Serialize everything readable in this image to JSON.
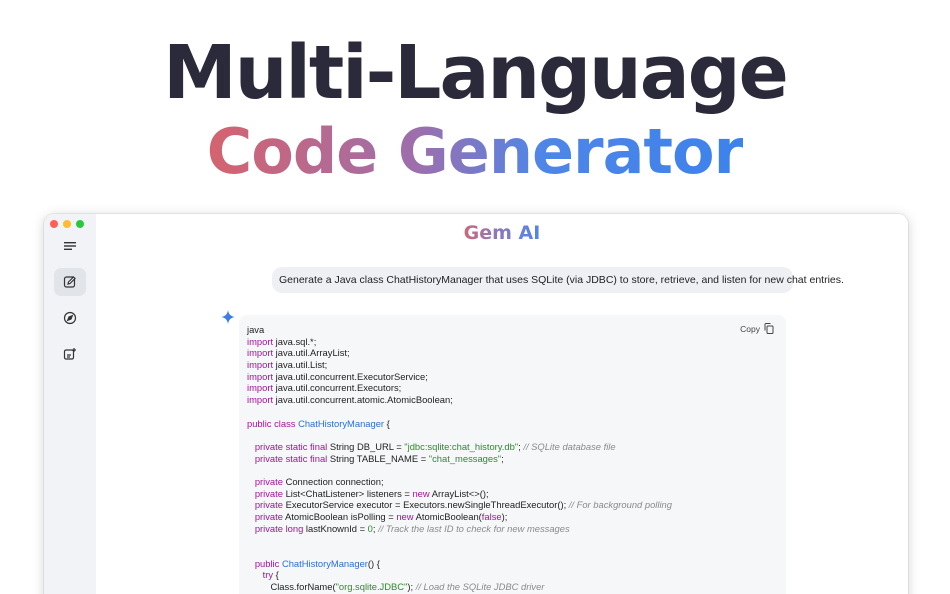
{
  "hero": {
    "title": "Multi-Language",
    "subtitle": "Code Generator"
  },
  "app": {
    "title": "Gem AI",
    "sidebar": {
      "items": [
        {
          "icon": "menu-icon"
        },
        {
          "icon": "new-chat-icon",
          "active": true
        },
        {
          "icon": "compass-icon"
        },
        {
          "icon": "add-note-icon"
        }
      ]
    }
  },
  "chat": {
    "user_message": "Generate a Java class ChatHistoryManager that uses SQLite (via JDBC) to store, retrieve, and listen for new chat entries.",
    "response": {
      "copy_label": "Copy",
      "language": "java",
      "code": {
        "import_kw": "import",
        "imports": [
          "java.sql.*;",
          "java.util.ArrayList;",
          "java.util.List;",
          "java.util.concurrent.ExecutorService;",
          "java.util.concurrent.Executors;",
          "java.util.concurrent.atomic.AtomicBoolean;"
        ],
        "class_decl": {
          "mods": "public class",
          "name": "ChatHistoryManager",
          "rest": " {"
        },
        "field1": {
          "mods": "private static final",
          "rest": " String DB_URL = ",
          "str": "\"jdbc:sqlite:chat_history.db\"",
          "end": "; ",
          "comment": "// SQLite database file"
        },
        "field2": {
          "mods": "private static final",
          "rest": " String TABLE_NAME = ",
          "str": "\"chat_messages\"",
          "end": ";"
        },
        "field3": {
          "mods": "private",
          "rest": " Connection connection;"
        },
        "field4": {
          "mods": "private",
          "rest": " List<ChatListener> listeners = ",
          "kw2": "new",
          "rest2": " ArrayList<>();"
        },
        "field5": {
          "mods": "private",
          "rest": " ExecutorService executor = Executors.newSingleThreadExecutor(); ",
          "comment": "// For background polling"
        },
        "field6": {
          "mods": "private",
          "rest": " AtomicBoolean isPolling = ",
          "kw2": "new",
          "rest2": " AtomicBoolean(",
          "kw3": "false",
          "rest3": ");"
        },
        "field7": {
          "mods": "private long",
          "rest": " lastKnownId = ",
          "num": "0",
          "end": "; ",
          "comment": "// Track the last ID to check for new messages"
        },
        "ctor": {
          "mods": "public",
          "name": "ChatHistoryManager",
          "rest": "() {"
        },
        "try_kw": "try",
        "try_rest": " {",
        "forname": {
          "rest": "Class.forName(",
          "str": "\"org.sqlite.JDBC\"",
          "end": "); ",
          "comment": "// Load the SQLite JDBC driver"
        }
      }
    }
  },
  "colors": {
    "keyword": "#a3149b",
    "class_name": "#2b6fd6",
    "string": "#2e8a2e",
    "comment": "#8a8a8a"
  }
}
